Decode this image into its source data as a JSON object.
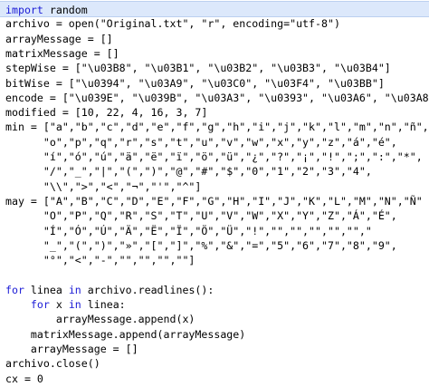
{
  "editor": {
    "current_line": 0,
    "lines": [
      [
        {
          "t": "import",
          "c": "kw"
        },
        {
          "t": " random"
        }
      ],
      [
        {
          "t": "archivo = open(\"Original.txt\", \"r\", encoding=\"utf-8\")"
        }
      ],
      [
        {
          "t": "arrayMessage = []"
        }
      ],
      [
        {
          "t": "matrixMessage = []"
        }
      ],
      [
        {
          "t": "stepWise = [\"\\u03B8\", \"\\u03B1\", \"\\u03B2\", \"\\u03B3\", \"\\u03B4\"]"
        }
      ],
      [
        {
          "t": "bitWise = [\"\\u0394\", \"\\u03A9\", \"\\u03C0\", \"\\u03F4\", \"\\u03BB\"]"
        }
      ],
      [
        {
          "t": "encode = [\"\\u039E\", \"\\u039B\", \"\\u03A3\", \"\\u0393\", \"\\u03A6\", \"\\u03A8\"]"
        }
      ],
      [
        {
          "t": "modified = [10, 22, 4, 16, 3, 7]"
        }
      ],
      [
        {
          "t": "min = [\"a\",\"b\",\"c\",\"d\",\"e\",\"f\",\"g\",\"h\",\"i\",\"j\",\"k\",\"l\",\"m\",\"n\",\"ñ\","
        }
      ],
      [
        {
          "t": "      \"o\",\"p\",\"q\",\"r\",\"s\",\"t\",\"u\",\"v\",\"w\",\"x\",\"y\",\"z\",\"á\",\"é\","
        }
      ],
      [
        {
          "t": "      \"í\",\"ó\",\"ú\",\"ä\",\"ë\",\"ï\",\"ö\",\"ü\",\"¿\",\"?\",\"¡\",\"!\",\";\",\":\",\"*\","
        }
      ],
      [
        {
          "t": "      \"/\",\"_\",\"|\",\"(\",\")\",\"@\",\"#\",\"$\",\"0\",\"1\",\"2\",\"3\",\"4\","
        }
      ],
      [
        {
          "t": "      \"\\\\\",\">\",\"<\",\"¬\",\"'\",\"^\"]"
        }
      ],
      [
        {
          "t": "may = [\"A\",\"B\",\"C\",\"D\",\"E\",\"F\",\"G\",\"H\",\"I\",\"J\",\"K\",\"L\",\"M\",\"N\",\"Ñ\""
        }
      ],
      [
        {
          "t": "      \"O\",\"P\",\"Q\",\"R\",\"S\",\"T\",\"U\",\"V\",\"W\",\"X\",\"Y\",\"Z\",\"Á\",\"É\","
        }
      ],
      [
        {
          "t": "      \"Í\",\"Ó\",\"Ú\",\"Ä\",\"Ë\",\"Ï\",\"Ö\",\"Ü\",\"!\",\"\",\"\",\"\",\"\",\"\",\""
        }
      ],
      [
        {
          "t": "      \"_\",\"(\",\")\",\"»\",\"[\",\"]\",\"%\",\"&\",\"=\",\"5\",\"6\",\"7\",\"8\",\"9\","
        }
      ],
      [
        {
          "t": "      \"°\",\"<\",\"-\",\"\",\"\",\"\",\"\"]"
        }
      ],
      [
        {
          "t": ""
        }
      ],
      [
        {
          "t": "for",
          "c": "kw"
        },
        {
          "t": " linea "
        },
        {
          "t": "in",
          "c": "kw"
        },
        {
          "t": " archivo.readlines():"
        }
      ],
      [
        {
          "t": "    "
        },
        {
          "t": "for",
          "c": "kw"
        },
        {
          "t": " x "
        },
        {
          "t": "in",
          "c": "kw"
        },
        {
          "t": " linea:"
        }
      ],
      [
        {
          "t": "        arrayMessage.append(x)"
        }
      ],
      [
        {
          "t": "    matrixMessage.append(arrayMessage)"
        }
      ],
      [
        {
          "t": "    arrayMessage = []"
        }
      ],
      [
        {
          "t": "archivo.close()"
        }
      ],
      [
        {
          "t": "cx = 0"
        }
      ],
      [
        {
          "t": "cy = 0"
        }
      ]
    ]
  }
}
